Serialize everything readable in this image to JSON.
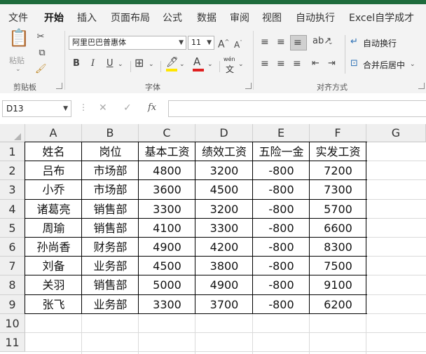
{
  "menu_tabs": [
    "文件",
    "开始",
    "插入",
    "页面布局",
    "公式",
    "数据",
    "审阅",
    "视图",
    "自动执行",
    "Excel自学成才"
  ],
  "active_tab": "开始",
  "clipboard": {
    "paste_label": "粘贴",
    "group_label": "剪贴板"
  },
  "font": {
    "name": "阿里巴巴普惠体",
    "size": "11",
    "grow": "A^",
    "shrink": "A^",
    "bold": "B",
    "italic": "I",
    "underline": "U",
    "phonetic_top": "wén",
    "phonetic_bottom": "文",
    "group_label": "字体",
    "font_color": "#e02020",
    "fill_color": "#ffe600"
  },
  "alignment": {
    "wrap_text": "自动换行",
    "merge_center": "合并后居中",
    "group_label": "对齐方式"
  },
  "formula_bar": {
    "name_box": "D13",
    "cancel": "✕",
    "enter": "✓",
    "fx": "fx",
    "value": ""
  },
  "columns": [
    "A",
    "B",
    "C",
    "D",
    "E",
    "F",
    "G"
  ],
  "rows": [
    "1",
    "2",
    "3",
    "4",
    "5",
    "6",
    "7",
    "8",
    "9",
    "10",
    "11"
  ],
  "table": [
    [
      "姓名",
      "岗位",
      "基本工资",
      "绩效工资",
      "五险一金",
      "实发工资"
    ],
    [
      "吕布",
      "市场部",
      "4800",
      "3200",
      "-800",
      "7200"
    ],
    [
      "小乔",
      "市场部",
      "3600",
      "4500",
      "-800",
      "7300"
    ],
    [
      "诸葛亮",
      "销售部",
      "3300",
      "3200",
      "-800",
      "5700"
    ],
    [
      "周瑜",
      "销售部",
      "4100",
      "3300",
      "-800",
      "6600"
    ],
    [
      "孙尚香",
      "财务部",
      "4900",
      "4200",
      "-800",
      "8300"
    ],
    [
      "刘备",
      "业务部",
      "4500",
      "3800",
      "-800",
      "7500"
    ],
    [
      "关羽",
      "销售部",
      "5000",
      "4900",
      "-800",
      "9100"
    ],
    [
      "张飞",
      "业务部",
      "3300",
      "3700",
      "-800",
      "6200"
    ]
  ]
}
